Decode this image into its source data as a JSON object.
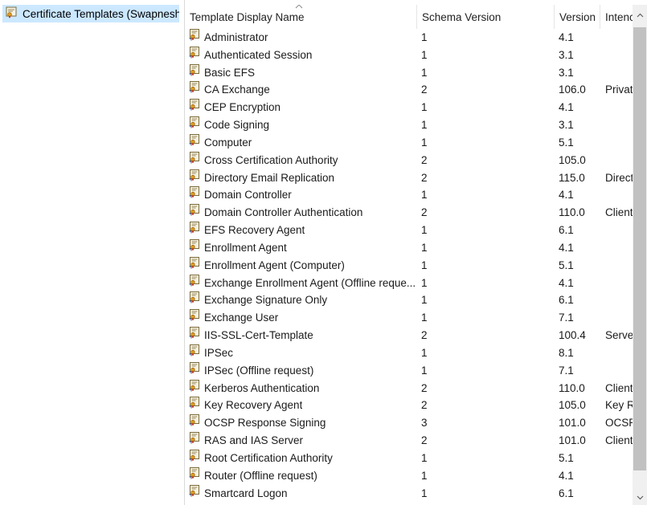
{
  "tree": {
    "selected_item_label": "Certificate Templates (Swapnesh-"
  },
  "list": {
    "columns": {
      "name": "Template Display Name",
      "schema": "Schema Version",
      "version": "Version",
      "intended": "Intenc"
    },
    "sort_column": "Template Display Name",
    "rows": [
      {
        "name": "Administrator",
        "schema": "1",
        "version": "4.1",
        "intended": ""
      },
      {
        "name": "Authenticated Session",
        "schema": "1",
        "version": "3.1",
        "intended": ""
      },
      {
        "name": "Basic EFS",
        "schema": "1",
        "version": "3.1",
        "intended": ""
      },
      {
        "name": "CA Exchange",
        "schema": "2",
        "version": "106.0",
        "intended": "Privat"
      },
      {
        "name": "CEP Encryption",
        "schema": "1",
        "version": "4.1",
        "intended": ""
      },
      {
        "name": "Code Signing",
        "schema": "1",
        "version": "3.1",
        "intended": ""
      },
      {
        "name": "Computer",
        "schema": "1",
        "version": "5.1",
        "intended": ""
      },
      {
        "name": "Cross Certification Authority",
        "schema": "2",
        "version": "105.0",
        "intended": ""
      },
      {
        "name": "Directory Email Replication",
        "schema": "2",
        "version": "115.0",
        "intended": "Direct"
      },
      {
        "name": "Domain Controller",
        "schema": "1",
        "version": "4.1",
        "intended": ""
      },
      {
        "name": "Domain Controller Authentication",
        "schema": "2",
        "version": "110.0",
        "intended": "Client"
      },
      {
        "name": "EFS Recovery Agent",
        "schema": "1",
        "version": "6.1",
        "intended": ""
      },
      {
        "name": "Enrollment Agent",
        "schema": "1",
        "version": "4.1",
        "intended": ""
      },
      {
        "name": "Enrollment Agent (Computer)",
        "schema": "1",
        "version": "5.1",
        "intended": ""
      },
      {
        "name": "Exchange Enrollment Agent (Offline reque...",
        "schema": "1",
        "version": "4.1",
        "intended": ""
      },
      {
        "name": "Exchange Signature Only",
        "schema": "1",
        "version": "6.1",
        "intended": ""
      },
      {
        "name": "Exchange User",
        "schema": "1",
        "version": "7.1",
        "intended": ""
      },
      {
        "name": "IIS-SSL-Cert-Template",
        "schema": "2",
        "version": "100.4",
        "intended": "Serve"
      },
      {
        "name": "IPSec",
        "schema": "1",
        "version": "8.1",
        "intended": ""
      },
      {
        "name": "IPSec (Offline request)",
        "schema": "1",
        "version": "7.1",
        "intended": ""
      },
      {
        "name": "Kerberos Authentication",
        "schema": "2",
        "version": "110.0",
        "intended": "Client"
      },
      {
        "name": "Key Recovery Agent",
        "schema": "2",
        "version": "105.0",
        "intended": "Key R"
      },
      {
        "name": "OCSP Response Signing",
        "schema": "3",
        "version": "101.0",
        "intended": "OCSP"
      },
      {
        "name": "RAS and IAS Server",
        "schema": "2",
        "version": "101.0",
        "intended": "Client"
      },
      {
        "name": "Root Certification Authority",
        "schema": "1",
        "version": "5.1",
        "intended": ""
      },
      {
        "name": "Router (Offline request)",
        "schema": "1",
        "version": "4.1",
        "intended": ""
      },
      {
        "name": "Smartcard Logon",
        "schema": "1",
        "version": "6.1",
        "intended": ""
      }
    ]
  },
  "icons": {
    "tree_item": "certificate-templates-icon",
    "row": "certificate-template-icon",
    "sort": "sort-ascending-caret-icon",
    "scroll_up": "scroll-up-arrow-icon",
    "scroll_down": "scroll-down-arrow-icon"
  },
  "colors": {
    "selection": "#cce8ff",
    "scroll_thumb": "#c1c1c1",
    "scroll_track": "#f0f0f0"
  }
}
